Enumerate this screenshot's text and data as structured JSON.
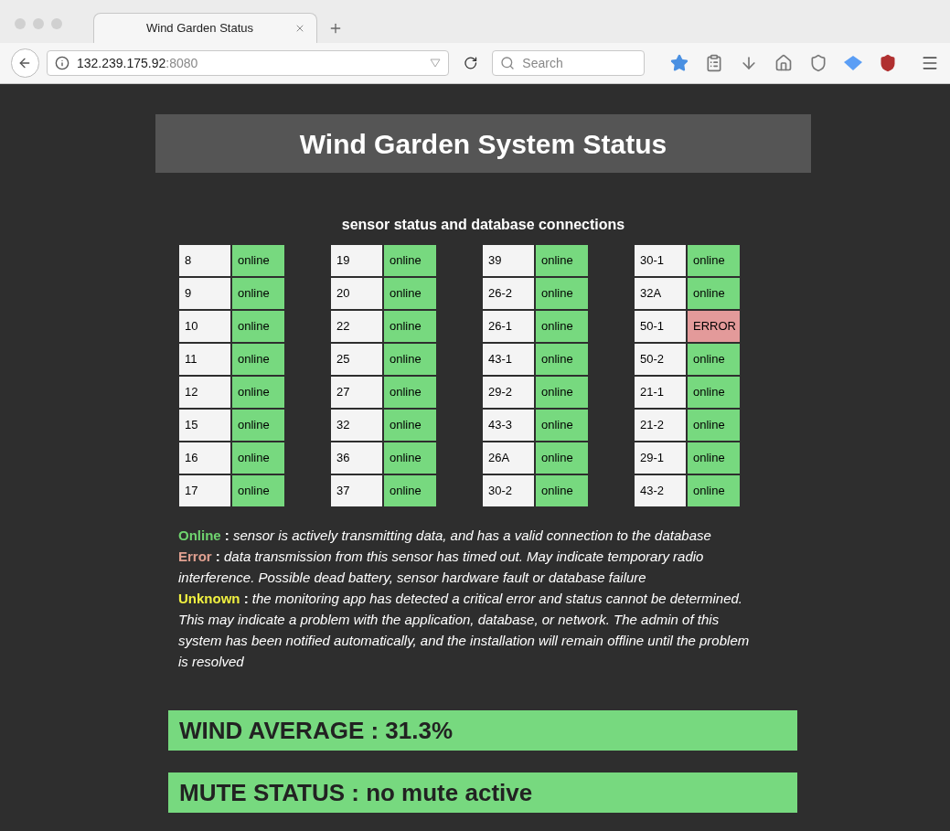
{
  "browser": {
    "tab_title": "Wind Garden Status",
    "address_host": "132.239.175.92",
    "address_port": ":8080",
    "search_placeholder": "Search"
  },
  "page": {
    "title": "Wind Garden System Status",
    "subtitle": "sensor status and database connections",
    "sensor_groups": [
      [
        {
          "id": "8",
          "status": "online",
          "error": false
        },
        {
          "id": "9",
          "status": "online",
          "error": false
        },
        {
          "id": "10",
          "status": "online",
          "error": false
        },
        {
          "id": "11",
          "status": "online",
          "error": false
        },
        {
          "id": "12",
          "status": "online",
          "error": false
        },
        {
          "id": "15",
          "status": "online",
          "error": false
        },
        {
          "id": "16",
          "status": "online",
          "error": false
        },
        {
          "id": "17",
          "status": "online",
          "error": false
        }
      ],
      [
        {
          "id": "19",
          "status": "online",
          "error": false
        },
        {
          "id": "20",
          "status": "online",
          "error": false
        },
        {
          "id": "22",
          "status": "online",
          "error": false
        },
        {
          "id": "25",
          "status": "online",
          "error": false
        },
        {
          "id": "27",
          "status": "online",
          "error": false
        },
        {
          "id": "32",
          "status": "online",
          "error": false
        },
        {
          "id": "36",
          "status": "online",
          "error": false
        },
        {
          "id": "37",
          "status": "online",
          "error": false
        }
      ],
      [
        {
          "id": "39",
          "status": "online",
          "error": false
        },
        {
          "id": "26-2",
          "status": "online",
          "error": false
        },
        {
          "id": "26-1",
          "status": "online",
          "error": false
        },
        {
          "id": "43-1",
          "status": "online",
          "error": false
        },
        {
          "id": "29-2",
          "status": "online",
          "error": false
        },
        {
          "id": "43-3",
          "status": "online",
          "error": false
        },
        {
          "id": "26A",
          "status": "online",
          "error": false
        },
        {
          "id": "30-2",
          "status": "online",
          "error": false
        }
      ],
      [
        {
          "id": "30-1",
          "status": "online",
          "error": false
        },
        {
          "id": "32A",
          "status": "online",
          "error": false
        },
        {
          "id": "50-1",
          "status": "ERROR",
          "error": true
        },
        {
          "id": "50-2",
          "status": "online",
          "error": false
        },
        {
          "id": "21-1",
          "status": "online",
          "error": false
        },
        {
          "id": "21-2",
          "status": "online",
          "error": false
        },
        {
          "id": "29-1",
          "status": "online",
          "error": false
        },
        {
          "id": "43-2",
          "status": "online",
          "error": false
        }
      ]
    ],
    "legend": [
      {
        "term": "Online",
        "color": "#6fd46f",
        "separator": ":",
        "text": "sensor is actively transmitting data, and has a valid connection to the database"
      },
      {
        "term": "Error",
        "color": "#e0a090",
        "separator": ":",
        "text": "data transmission from this sensor has timed out. May indicate temporary radio interference. Possible dead battery, sensor hardware fault or database failure"
      },
      {
        "term": "Unknown",
        "color": "#f0f040",
        "separator": ":",
        "text": "the monitoring app has detected a critical error and status cannot be determined. This may indicate a problem with the application, database, or network. The admin of this system has been notified automatically, and the installation will remain offline until the problem is resolved"
      }
    ],
    "banners": [
      "WIND AVERAGE : 31.3%",
      "MUTE STATUS : no mute active"
    ]
  }
}
